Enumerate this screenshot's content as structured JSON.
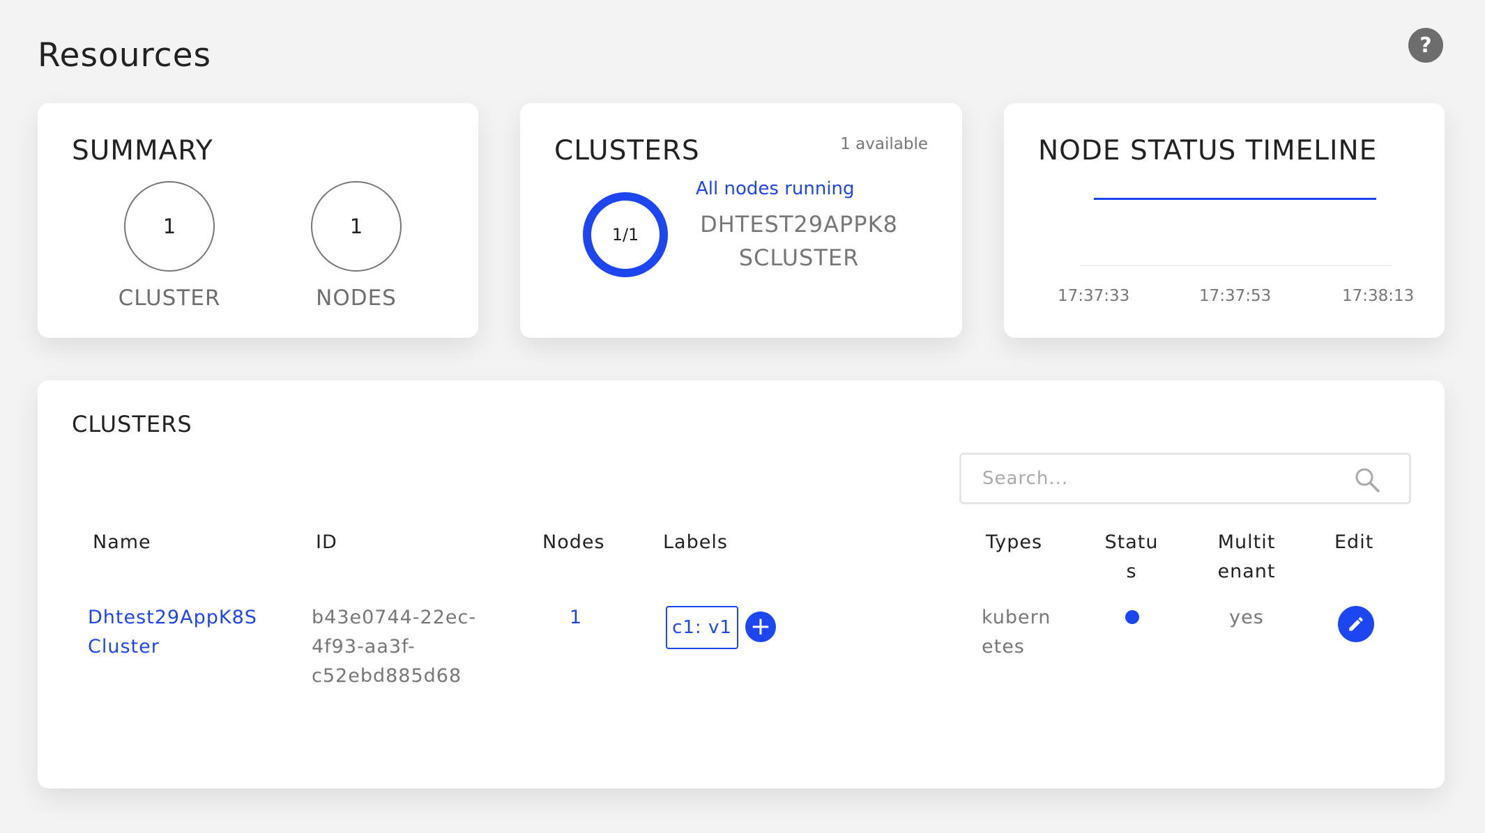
{
  "page": {
    "title": "Resources",
    "help_icon": "question-mark-icon",
    "help_label": "?"
  },
  "summary": {
    "title": "SUMMARY",
    "stats": [
      {
        "value": "1",
        "label": "CLUSTER"
      },
      {
        "value": "1",
        "label": "NODES"
      }
    ]
  },
  "clusters_overview": {
    "title": "CLUSTERS",
    "available": "1 available",
    "ratio": "1/1",
    "status": "All nodes running",
    "cluster_name_line1": "DHTEST29APPK8",
    "cluster_name_line2": "SCLUSTER",
    "accent_color": "#1e46f0"
  },
  "timeline": {
    "title": "NODE STATUS TIMELINE",
    "ticks": [
      "17:37:33",
      "17:37:53",
      "17:38:13"
    ]
  },
  "clusters_table": {
    "title": "CLUSTERS",
    "search_placeholder": "Search...",
    "columns": {
      "name": "Name",
      "id": "ID",
      "nodes": "Nodes",
      "labels": "Labels",
      "types": "Types",
      "status_line1": "Statu",
      "status_line2": "s",
      "multitenant_line1": "Multit",
      "multitenant_line2": "enant",
      "edit": "Edit"
    },
    "rows": [
      {
        "name_line1": "Dhtest29AppK8S",
        "name_line2": "Cluster",
        "id_line1": "b43e0744-22ec-",
        "id_line2": "4f93-aa3f-",
        "id_line3": "c52ebd885d68",
        "nodes": "1",
        "label": "c1: v1",
        "add_label": "+",
        "types_line1": "kubern",
        "types_line2": "etes",
        "status": "running",
        "multitenant": "yes"
      }
    ]
  }
}
